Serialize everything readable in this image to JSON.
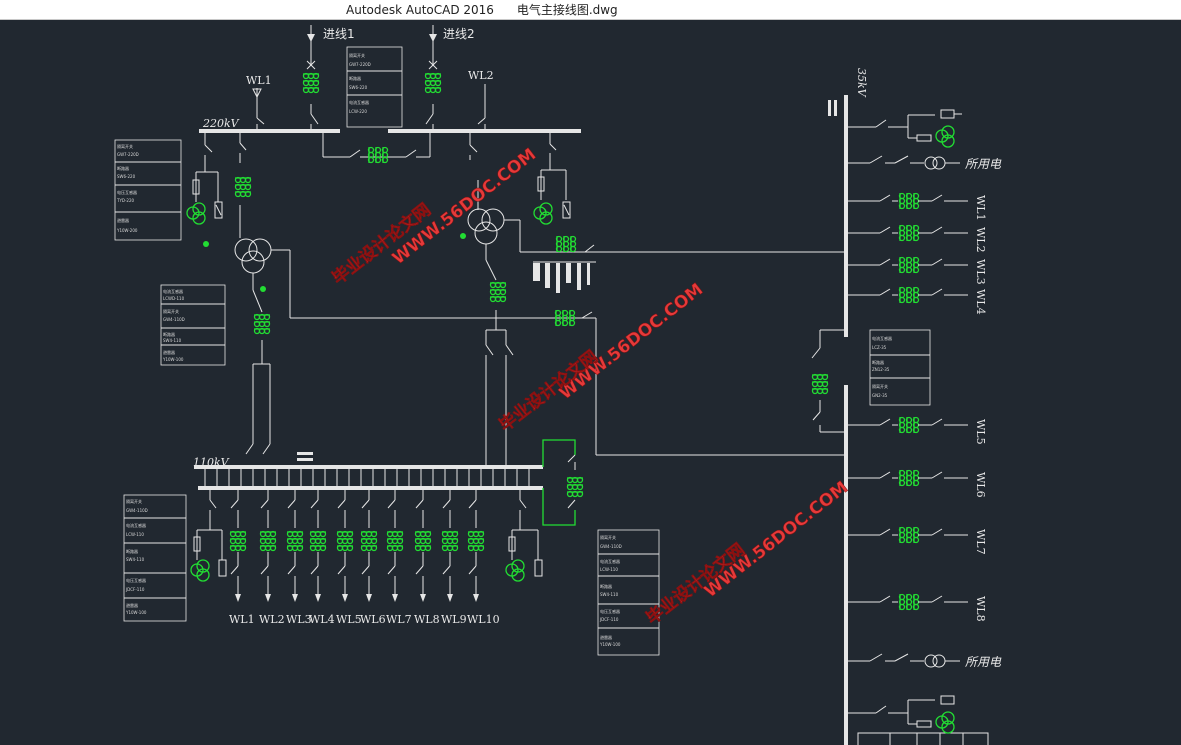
{
  "window": {
    "app_title": "Autodesk AutoCAD 2016",
    "file_name": "电气主接线图.dwg"
  },
  "diagram": {
    "incoming": [
      "进线1",
      "进线2"
    ],
    "bus_220": "220kV",
    "bus_110": "110kV",
    "bus_35": "35kV",
    "top_feeders": [
      "WL1",
      "WL2"
    ],
    "feeders_110": [
      "WL1",
      "WL2",
      "WL3",
      "WL4",
      "WL5",
      "WL6",
      "WL7",
      "WL8",
      "WL9",
      "WL10"
    ],
    "feeders_35_upper": [
      "WL1",
      "WL2",
      "WL3",
      "WL4"
    ],
    "feeders_35_lower": [
      "WL5",
      "WL6",
      "WL7",
      "WL8"
    ],
    "station_service": "所用电"
  },
  "watermark": {
    "url": "WWW.56DOC.COM",
    "cn": "毕业设计论文网"
  },
  "colors": {
    "background": "#212830",
    "lines": "#e6e6e6",
    "ct_green": "#22dd33",
    "watermark": "#e53a3a"
  }
}
